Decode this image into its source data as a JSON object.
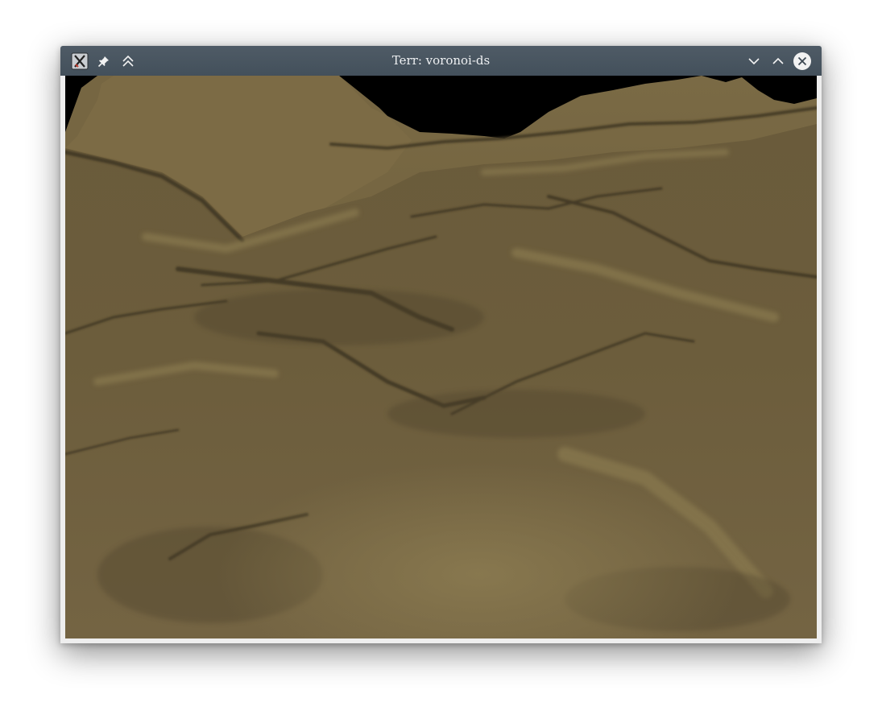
{
  "window": {
    "title": "Terr:  voronoi-ds",
    "app_icon": "x-app-icon",
    "buttons": {
      "pin": "pin-icon",
      "keep_above": "double-chevron-up-icon",
      "minimize": "chevron-down-icon",
      "maximize": "chevron-up-icon",
      "close": "close-icon"
    }
  },
  "viewport": {
    "content": "3D terrain render",
    "colors": {
      "sky": "#000000",
      "terrain_base": "#6e5f3e",
      "terrain_shadow": "#4a3f27",
      "terrain_highlight": "#8c7c52"
    }
  }
}
